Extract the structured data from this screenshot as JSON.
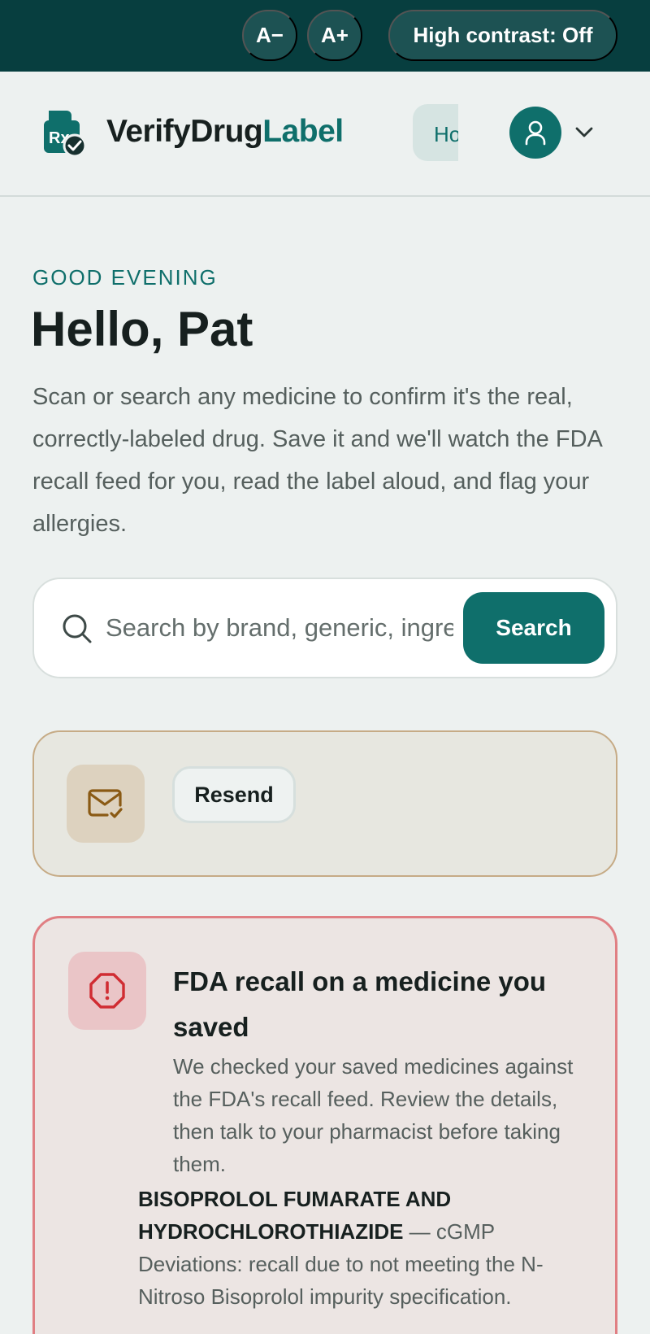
{
  "accessibility": {
    "decrease_label": "A−",
    "increase_label": "A+",
    "contrast_label": "High contrast: Off"
  },
  "header": {
    "brand_part1": "VerifyDrug",
    "brand_part2": "Label",
    "logo_text": "Rx",
    "home_tab_label": "Home",
    "avatar_icon": "user-icon",
    "menu_icon": "chevron-down-icon"
  },
  "greeting": {
    "eyebrow": "GOOD EVENING",
    "title": "Hello, Pat",
    "intro": "Scan or search any medicine to confirm it's the real, correctly-labeled drug. Save it and we'll watch the FDA recall feed for you, read the label aloud, and flag your allergies."
  },
  "search": {
    "placeholder": "Search by brand, generic, ingredient",
    "value": "",
    "button_label": "Search",
    "icon": "search-icon"
  },
  "verify_banner": {
    "icon": "mail-check-icon",
    "resend_label": "Resend"
  },
  "recall": {
    "icon": "alert-octagon-icon",
    "title": "FDA recall on a medicine you saved",
    "body": "We checked your saved medicines against the FDA's recall feed. Review the details, then talk to your pharmacist before taking them.",
    "drug_name": "BISOPROLOL FUMARATE AND HYDROCHLOROTHIAZIDE",
    "reason": " — cGMP Deviations: recall due to not meeting the N-Nitroso Bisoprolol impurity specification."
  },
  "colors": {
    "topbar": "#073e3f",
    "accent": "#0f6f6b",
    "recall_border": "#e07f83",
    "verify_border": "#c6ab86"
  }
}
